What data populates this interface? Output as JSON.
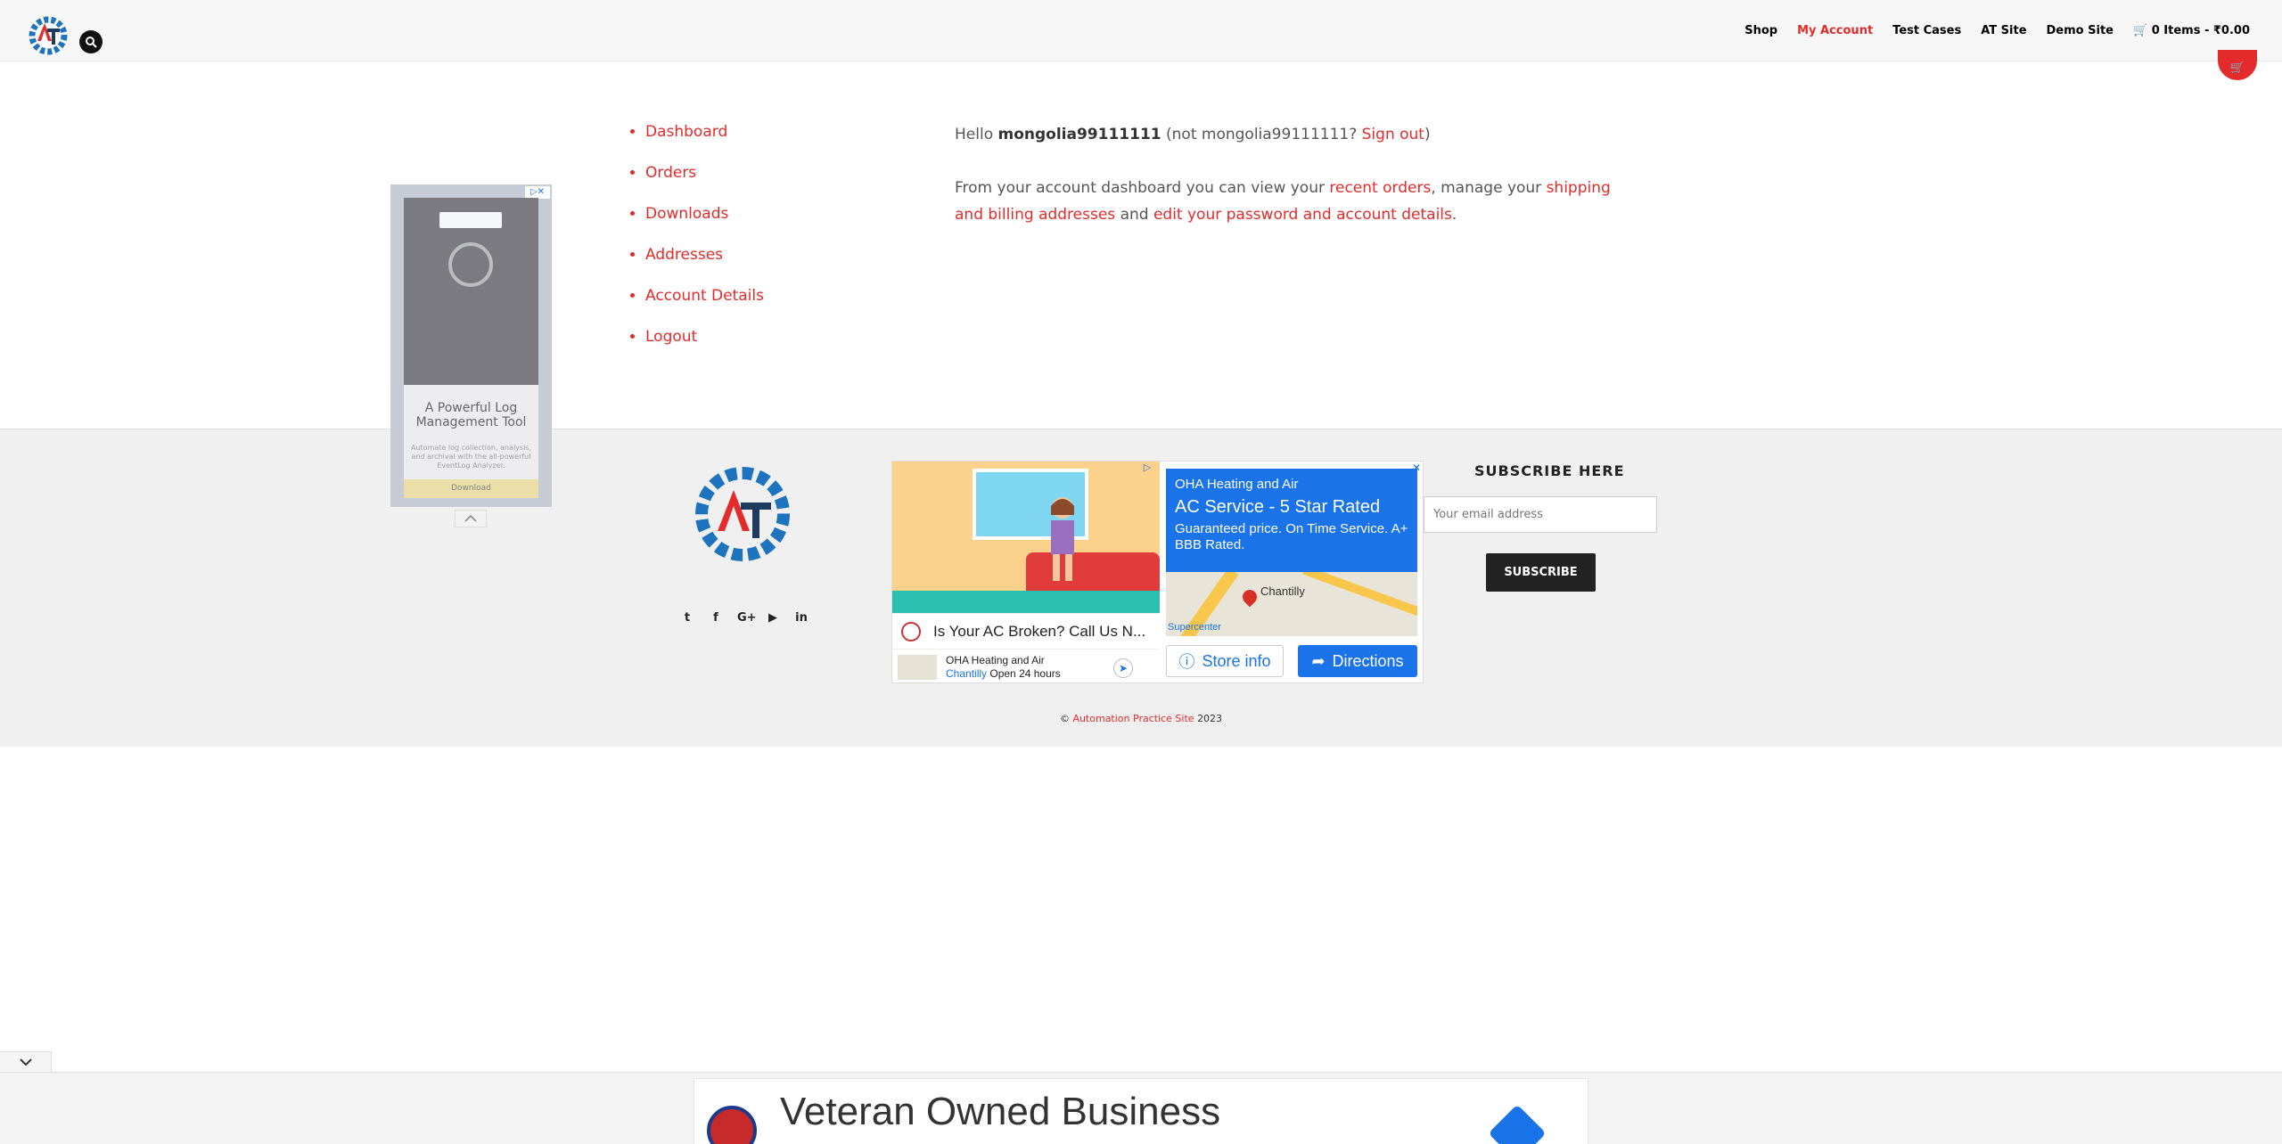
{
  "header": {
    "nav": [
      {
        "label": "Shop",
        "active": false
      },
      {
        "label": "My Account",
        "active": true
      },
      {
        "label": "Test Cases",
        "active": false
      },
      {
        "label": "AT Site",
        "active": false
      },
      {
        "label": "Demo Site",
        "active": false
      }
    ],
    "cart_label": "0 Items - ₹0.00"
  },
  "account_nav": [
    "Dashboard",
    "Orders",
    "Downloads",
    "Addresses",
    "Account Details",
    "Logout"
  ],
  "account": {
    "hello": "Hello",
    "username": "mongolia99111111",
    "not_prefix": "(not mongolia99111111?",
    "sign_out": "Sign out",
    "close_paren": ")",
    "dash_text_1": "From your account dashboard you can view your",
    "recent_orders": "recent orders",
    "dash_text_2": ", manage your",
    "addresses_link": "shipping and billing addresses",
    "dash_text_3": "and",
    "account_link": "edit your password and account details",
    "dash_text_4": "."
  },
  "ad_left": {
    "headline": "A Powerful Log Management Tool",
    "description": "Automate log collection, analysis, and archival with the all-powerful EventLog Analyzer.",
    "cta": "Download"
  },
  "ad_mid": {
    "ask": "Is Your AC Broken? Call Us N...",
    "business": "OHA Heating and Air",
    "town": "Chantilly",
    "hours": "Open 24 hours",
    "advertiser": "OHA Heating and Air",
    "headline": "AC Service - 5 Star Rated",
    "body": "Guaranteed price. On Time Service. A+ BBB Rated.",
    "map_city": "Chantilly",
    "map_poi": "Supercenter",
    "store_info": "Store info",
    "directions": "Directions"
  },
  "subscribe": {
    "title": "SUBSCRIBE HERE",
    "placeholder": "Your email address",
    "button": "SUBSCRIBE"
  },
  "footer": {
    "copy_symbol": "©",
    "site_link": "Automation Practice Site",
    "year": "2023"
  },
  "bottom_ad": {
    "headline": "Veteran Owned Business"
  },
  "colors": {
    "accent": "#e42b2b",
    "ad_blue": "#1a73e8",
    "footer_bg": "#f0f0f0"
  }
}
